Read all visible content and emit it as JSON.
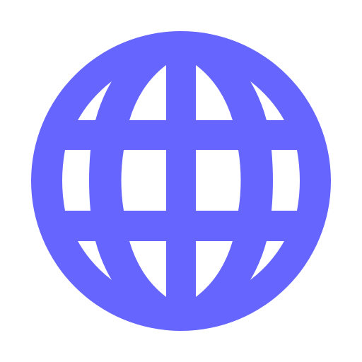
{
  "icon": {
    "name": "globe-icon",
    "color": "#6666ff",
    "background": "#ffffff"
  }
}
